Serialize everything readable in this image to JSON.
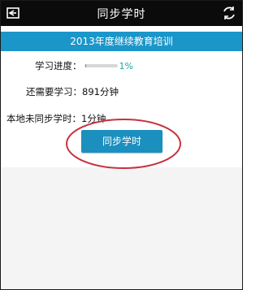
{
  "header": {
    "title": "同步学时",
    "back_icon": "back-icon",
    "refresh_icon": "refresh-icon"
  },
  "banner": {
    "text": "2013年度继续教育培训"
  },
  "progress": {
    "label": "学习进度：",
    "value_text": "1%",
    "value": 0.01
  },
  "remaining": {
    "label": "还需要学习：",
    "value": "891分钟"
  },
  "unsynced": {
    "label": "本地未同步学时：",
    "value": "1分钟"
  },
  "sync_button": {
    "label": "同步学时"
  },
  "colors": {
    "topbar": "#0b0b0b",
    "accent": "#1b96c9",
    "button": "#1b8fbe",
    "annotation": "#c8323f"
  }
}
